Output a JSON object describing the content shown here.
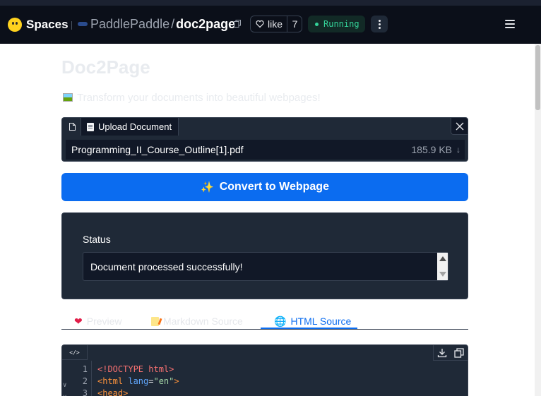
{
  "header": {
    "brand": "Spaces",
    "org": "PaddlePaddle",
    "slash": "/",
    "repo": "doc2page",
    "like_label": "like",
    "like_count": "7",
    "status": "Running"
  },
  "app": {
    "title": "Doc2Page",
    "description": "Transform your documents into beautiful webpages!"
  },
  "upload": {
    "label": "Upload Document",
    "file_name": "Programming_II_Course_Outline[1].pdf",
    "file_size": "185.9 KB",
    "download_glyph": "↓"
  },
  "convert": {
    "icon": "✨",
    "label": "Convert to Webpage"
  },
  "status": {
    "label": "Status",
    "value": "Document processed successfully!"
  },
  "tabs": [
    {
      "label": "Preview",
      "icon": "❤"
    },
    {
      "label": "Markdown Source",
      "icon": "memo"
    },
    {
      "label": "HTML Source",
      "icon": "🌐",
      "selected": true
    }
  ],
  "code": {
    "tab_glyph": "</>",
    "lines": [
      {
        "num": "1",
        "fold": "",
        "parts": [
          "<!DOCTYPE html>"
        ]
      },
      {
        "num": "2",
        "fold": "∨",
        "parts": [
          "<html",
          " lang",
          "=",
          "\"en\"",
          ">"
        ]
      },
      {
        "num": "3",
        "fold": "∨",
        "parts": [
          "<head>"
        ]
      }
    ]
  },
  "colors": {
    "accent": "#0b6cf0",
    "panel": "#1f2937",
    "running": "#34d399"
  },
  "icons": [
    "hugging-face-logo",
    "copy-icon",
    "heart-icon",
    "kebab-menu-icon",
    "hamburger-menu-icon",
    "file-icon",
    "close-icon",
    "download-icon",
    "copy-code-icon"
  ]
}
